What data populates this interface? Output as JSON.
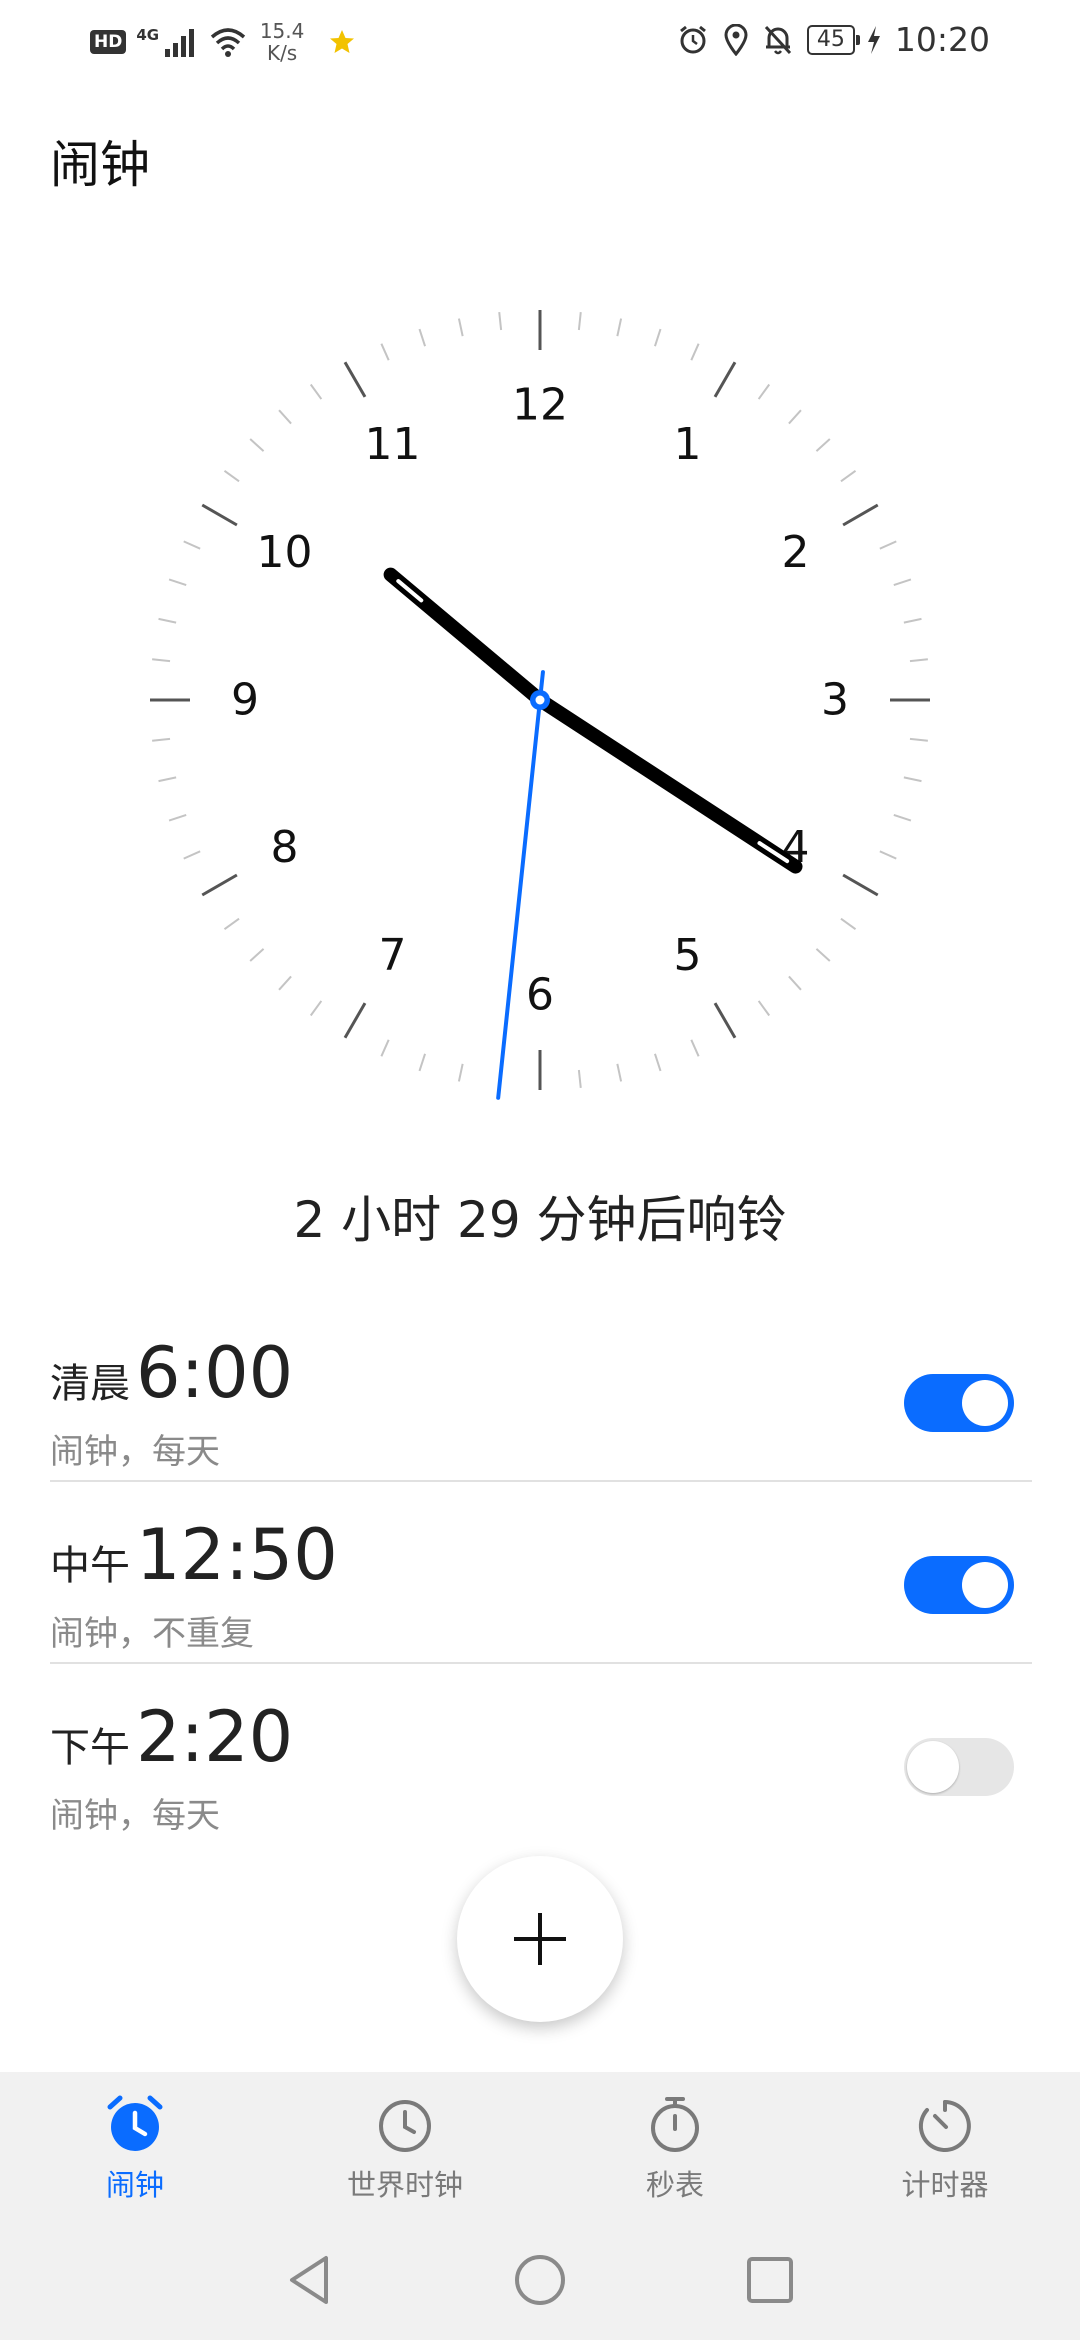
{
  "status_bar": {
    "hd": "HD",
    "network": "4G",
    "speed_value": "15.4",
    "speed_unit": "K/s",
    "battery": "45",
    "time": "10:20"
  },
  "title": "闹钟",
  "clock": {
    "numbers": [
      "12",
      "1",
      "2",
      "3",
      "4",
      "5",
      "6",
      "7",
      "8",
      "9",
      "10",
      "11"
    ],
    "hour": 10,
    "minute": 20,
    "second": 31,
    "accent": "#0a6cff"
  },
  "countdown": "2 小时 29 分钟后响铃",
  "alarms": [
    {
      "period": "清晨",
      "time": "6:00",
      "subtitle": "闹钟，每天",
      "enabled": true
    },
    {
      "period": "中午",
      "time": "12:50",
      "subtitle": "闹钟，不重复",
      "enabled": true
    },
    {
      "period": "下午",
      "time": "2:20",
      "subtitle": "闹钟，每天",
      "enabled": false
    }
  ],
  "nav": [
    {
      "label": "闹钟",
      "icon": "alarm-clock-icon",
      "active": true
    },
    {
      "label": "世界时钟",
      "icon": "world-clock-icon",
      "active": false
    },
    {
      "label": "秒表",
      "icon": "stopwatch-icon",
      "active": false
    },
    {
      "label": "计时器",
      "icon": "timer-icon",
      "active": false
    }
  ]
}
